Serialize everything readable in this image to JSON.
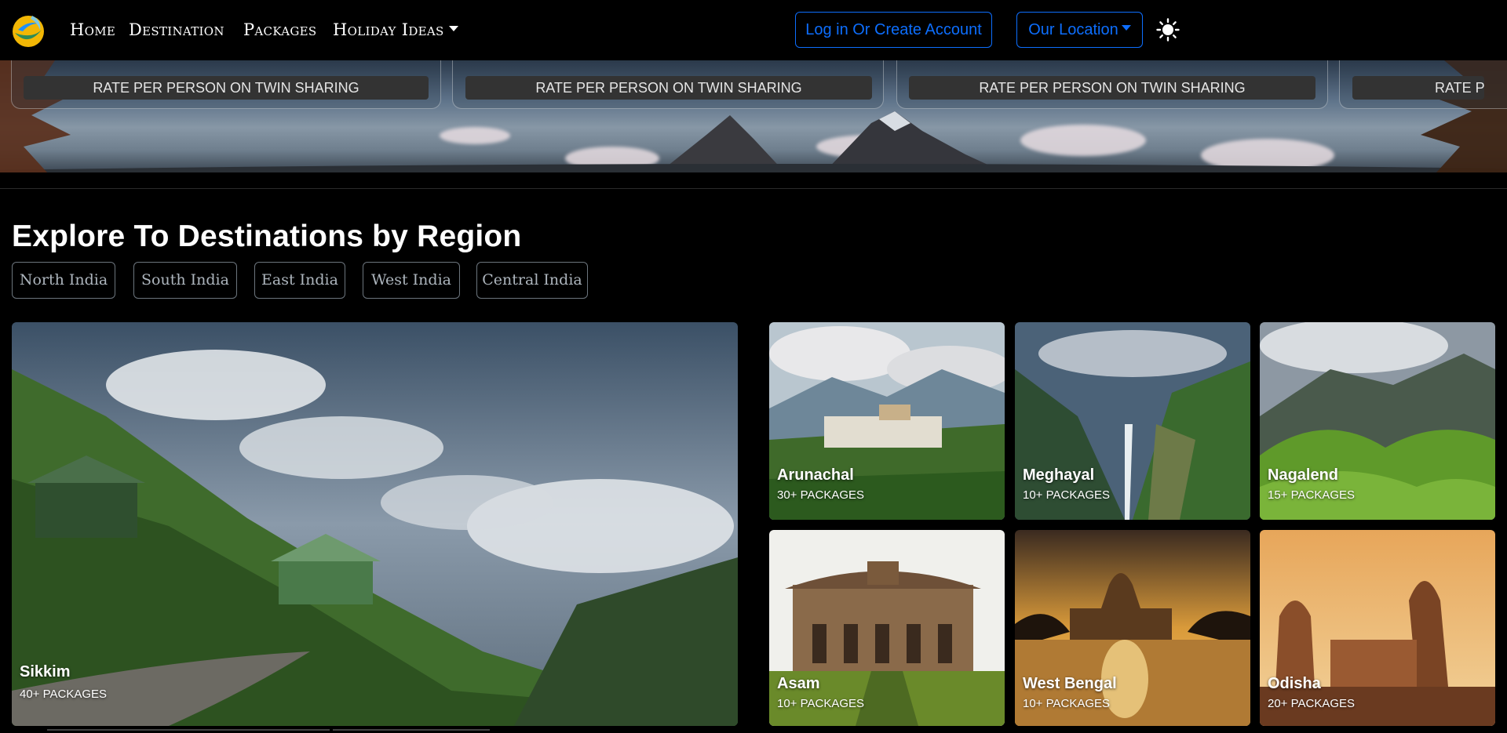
{
  "nav": {
    "links": [
      "Home",
      "Destination",
      "Packages",
      "Holiday Ideas"
    ],
    "login": "Log in Or Create Account",
    "location": "Our Location"
  },
  "banner": {
    "rates": [
      "RATE PER PERSON ON TWIN SHARING",
      "RATE PER PERSON ON TWIN SHARING",
      "RATE PER PERSON ON TWIN SHARING",
      "RATE PE"
    ]
  },
  "section": {
    "title": "Explore To Destinations by Region",
    "regions": [
      "North India",
      "South India",
      "East India",
      "West India",
      "Central India"
    ]
  },
  "destinations": [
    {
      "name": "Sikkim",
      "count": "40+ PACKAGES"
    },
    {
      "name": "Arunachal",
      "count": "30+ PACKAGES"
    },
    {
      "name": "Meghayal",
      "count": "10+ PACKAGES"
    },
    {
      "name": "Nagalend",
      "count": "15+ PACKAGES"
    },
    {
      "name": "Asam",
      "count": "10+ PACKAGES"
    },
    {
      "name": "West Bengal",
      "count": "10+ PACKAGES"
    },
    {
      "name": "Odisha",
      "count": "20+ PACKAGES"
    }
  ],
  "colors": {
    "accent": "#0d6efd",
    "background": "#000000"
  }
}
